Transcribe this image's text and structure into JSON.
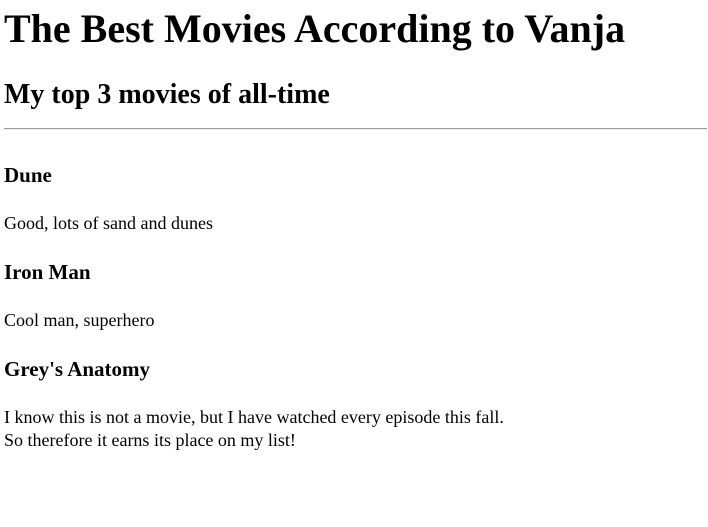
{
  "page": {
    "title": "The Best Movies According to Vanja",
    "subtitle": "My top 3 movies of all-time"
  },
  "movies": [
    {
      "title": "Dune",
      "lines": [
        "Good, lots of sand and dunes"
      ]
    },
    {
      "title": "Iron Man",
      "lines": [
        "Cool man, superhero"
      ]
    },
    {
      "title": "Grey's Anatomy",
      "lines": [
        "I know this is not a movie, but I have watched every episode this fall.",
        "So therefore it earns its place on my list!"
      ]
    }
  ]
}
